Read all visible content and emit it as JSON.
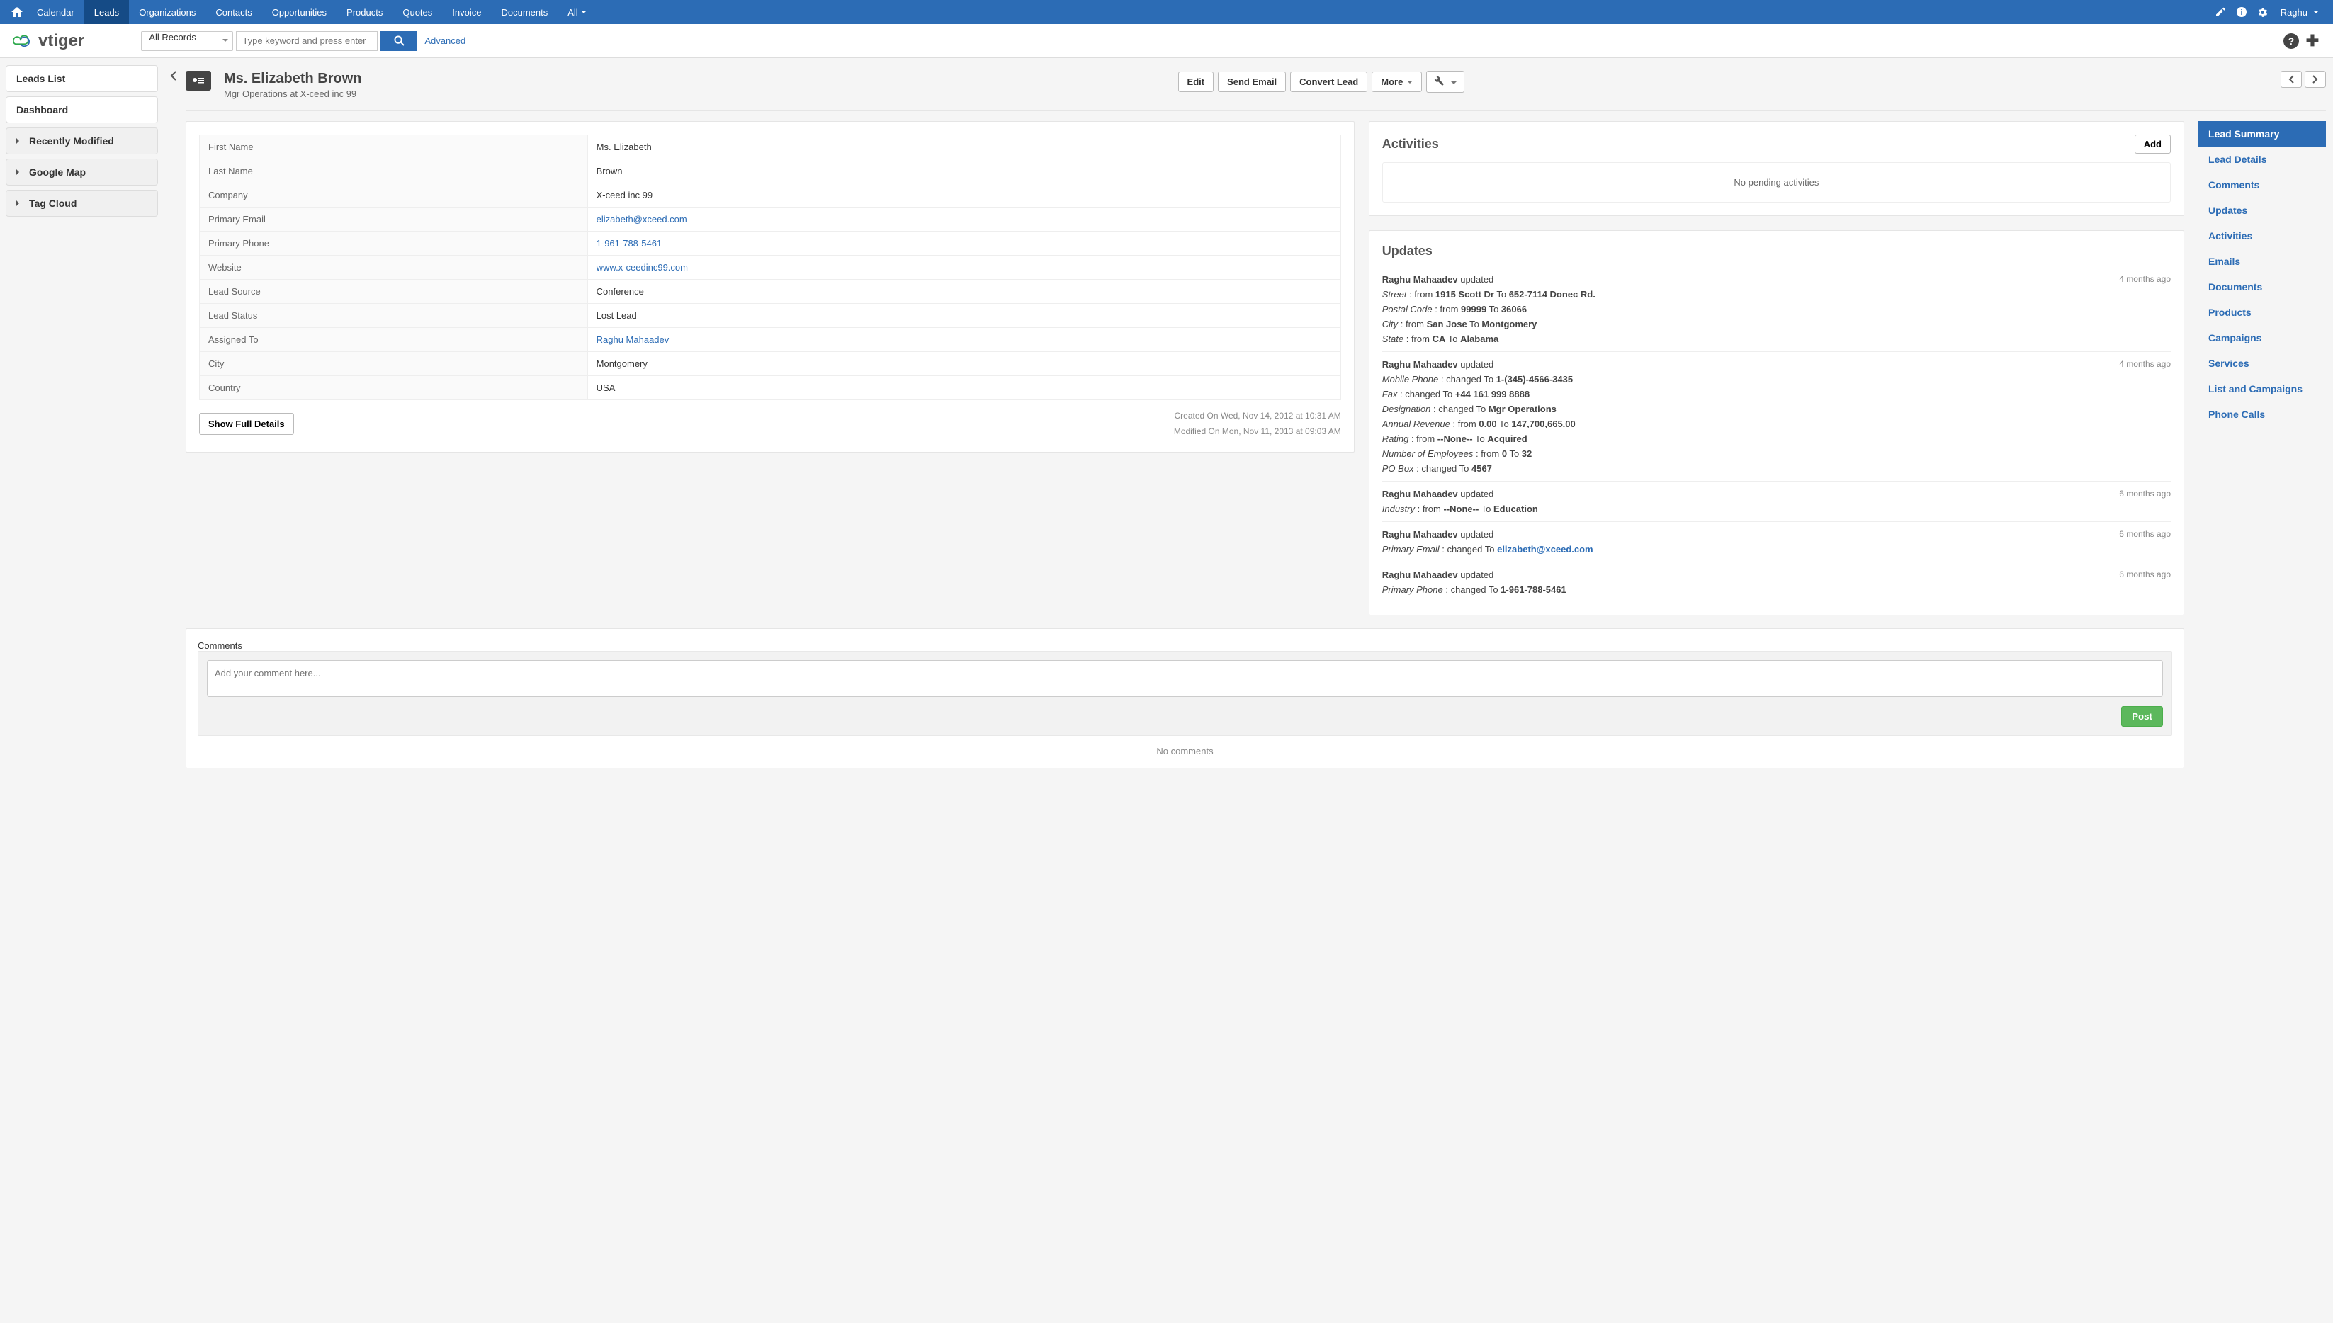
{
  "topnav": {
    "items": [
      "Calendar",
      "Leads",
      "Organizations",
      "Contacts",
      "Opportunities",
      "Products",
      "Quotes",
      "Invoice",
      "Documents",
      "All"
    ],
    "active_index": 1,
    "user": "Raghu"
  },
  "search": {
    "scope": "All Records",
    "placeholder": "Type keyword and press enter",
    "advanced": "Advanced"
  },
  "sidebar": {
    "links": [
      "Leads List",
      "Dashboard"
    ],
    "widgets": [
      "Recently Modified",
      "Google Map",
      "Tag Cloud"
    ]
  },
  "record": {
    "title": "Ms. Elizabeth Brown",
    "subtitle": "Mgr Operations at X-ceed inc 99",
    "actions": {
      "edit": "Edit",
      "send_email": "Send Email",
      "convert": "Convert Lead",
      "more": "More"
    }
  },
  "details": {
    "rows": [
      {
        "label": "First Name",
        "value": "Ms. Elizabeth",
        "link": false
      },
      {
        "label": "Last Name",
        "value": "Brown",
        "link": false
      },
      {
        "label": "Company",
        "value": "X-ceed inc 99",
        "link": false
      },
      {
        "label": "Primary Email",
        "value": "elizabeth@xceed.com",
        "link": true
      },
      {
        "label": "Primary Phone",
        "value": "1-961-788-5461",
        "link": true
      },
      {
        "label": "Website",
        "value": "www.x-ceedinc99.com",
        "link": true
      },
      {
        "label": "Lead Source",
        "value": "Conference",
        "link": false
      },
      {
        "label": "Lead Status",
        "value": "Lost Lead",
        "link": false
      },
      {
        "label": "Assigned To",
        "value": "Raghu Mahaadev",
        "link": true
      },
      {
        "label": "City",
        "value": "Montgomery",
        "link": false
      },
      {
        "label": "Country",
        "value": "USA",
        "link": false
      }
    ],
    "show_full": "Show Full Details",
    "created": "Created On Wed, Nov 14, 2012 at 10:31 AM",
    "modified": "Modified On Mon, Nov 11, 2013 at 09:03 AM"
  },
  "activities": {
    "title": "Activities",
    "add": "Add",
    "empty": "No pending activities"
  },
  "updates": {
    "title": "Updates",
    "items": [
      {
        "who": "Raghu Mahaadev",
        "action": "updated",
        "ago": "4 months ago",
        "changes": [
          {
            "field": "Street",
            "text_before": "from",
            "from": "1915 Scott Dr",
            "to": "652-7114 Donec Rd."
          },
          {
            "field": "Postal Code",
            "text_before": "from",
            "from": "99999",
            "to": "36066"
          },
          {
            "field": "City",
            "text_before": "from",
            "from": "San Jose",
            "to": "Montgomery"
          },
          {
            "field": "State",
            "text_before": "from",
            "from": "CA",
            "to": "Alabama"
          }
        ]
      },
      {
        "who": "Raghu Mahaadev",
        "action": "updated",
        "ago": "4 months ago",
        "changes": [
          {
            "field": "Mobile Phone",
            "text_before": "changed To",
            "single": "1-(345)-4566-3435"
          },
          {
            "field": "Fax",
            "text_before": "changed To",
            "single": "+44 161 999 8888"
          },
          {
            "field": "Designation",
            "text_before": "changed To",
            "single": "Mgr Operations"
          },
          {
            "field": "Annual Revenue",
            "text_before": "from",
            "from": "0.00",
            "to": "147,700,665.00"
          },
          {
            "field": "Rating",
            "text_before": "from",
            "from": "--None--",
            "to": "Acquired"
          },
          {
            "field": "Number of Employees",
            "text_before": "from",
            "from": "0",
            "to": "32"
          },
          {
            "field": "PO Box",
            "text_before": "changed To",
            "single": "4567"
          }
        ]
      },
      {
        "who": "Raghu Mahaadev",
        "action": "updated",
        "ago": "6 months ago",
        "changes": [
          {
            "field": "Industry",
            "text_before": "from",
            "from": "--None--",
            "to": "Education"
          }
        ]
      },
      {
        "who": "Raghu Mahaadev",
        "action": "updated",
        "ago": "6 months ago",
        "changes": [
          {
            "field": "Primary Email",
            "text_before": "changed To",
            "single": "elizabeth@xceed.com",
            "link": true
          }
        ]
      },
      {
        "who": "Raghu Mahaadev",
        "action": "updated",
        "ago": "6 months ago",
        "changes": [
          {
            "field": "Primary Phone",
            "text_before": "changed To",
            "single": "1-961-788-5461"
          }
        ]
      }
    ]
  },
  "comments": {
    "title": "Comments",
    "placeholder": "Add your comment here...",
    "post": "Post",
    "empty": "No comments"
  },
  "right_tabs": {
    "items": [
      "Lead Summary",
      "Lead Details",
      "Comments",
      "Updates",
      "Activities",
      "Emails",
      "Documents",
      "Products",
      "Campaigns",
      "Services",
      "List and Campaigns",
      "Phone Calls"
    ],
    "active_index": 0
  }
}
